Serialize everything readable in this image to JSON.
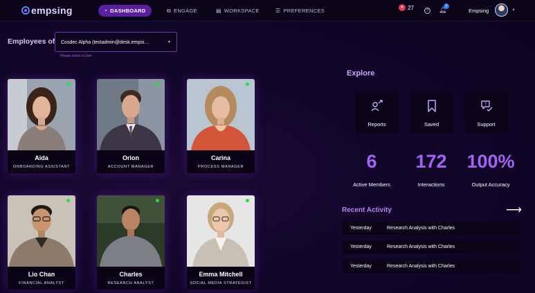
{
  "header": {
    "logo": "empsing",
    "nav": [
      {
        "label": "DASHBOARD",
        "icon": "dashboard-icon",
        "active": true
      },
      {
        "label": "ENGAGE",
        "icon": "engage-icon",
        "active": false
      },
      {
        "label": "WORKSPACE",
        "icon": "workspace-icon",
        "active": false
      },
      {
        "label": "PREFERENCES",
        "icon": "sliders-icon",
        "active": false
      }
    ],
    "likes": "27",
    "notification_count": "1",
    "user_name": "Empsing"
  },
  "employees_of": {
    "label": "Employees of",
    "selected": "Cosdec Alpha (testadmin@desk.empsi…",
    "hint": "Please select a User"
  },
  "employees": [
    {
      "name": "Aida",
      "role": "ONBOARDING ASSISTANT",
      "online": true
    },
    {
      "name": "Orion",
      "role": "ACCOUNT MANAGER",
      "online": true
    },
    {
      "name": "Carina",
      "role": "PROCESS MANAGER",
      "online": true
    },
    {
      "name": "Lio Chan",
      "role": "FINANCIAL ANALYST",
      "online": true
    },
    {
      "name": "Charles",
      "role": "RESEARCH ANALYST",
      "online": true
    },
    {
      "name": "Emma Mitchell",
      "role": "SOCIAL MEDIA STRATEGIST",
      "online": true
    }
  ],
  "explore": {
    "title": "Explore",
    "tiles": [
      {
        "label": "Reports",
        "icon": "reports-icon"
      },
      {
        "label": "Saved",
        "icon": "bookmark-icon"
      },
      {
        "label": "Support",
        "icon": "support-icon"
      }
    ]
  },
  "stats": [
    {
      "value": "6",
      "label": "Active Members"
    },
    {
      "value": "172",
      "label": "Interactions"
    },
    {
      "value": "100%",
      "label": "Output Accuracy"
    }
  ],
  "recent_activity": {
    "title": "Recent Activity",
    "items": [
      {
        "date": "Yesterday",
        "text": "Research Analysis with Charles"
      },
      {
        "date": "Yesterday",
        "text": "Research Analysis with Charles"
      },
      {
        "date": "Yesterday",
        "text": "Research Analysis with Charles"
      }
    ]
  },
  "colors": {
    "accent": "#a463f2",
    "nav_active": "#5b1ea0",
    "online": "#22e04a",
    "background": "#12062a"
  }
}
